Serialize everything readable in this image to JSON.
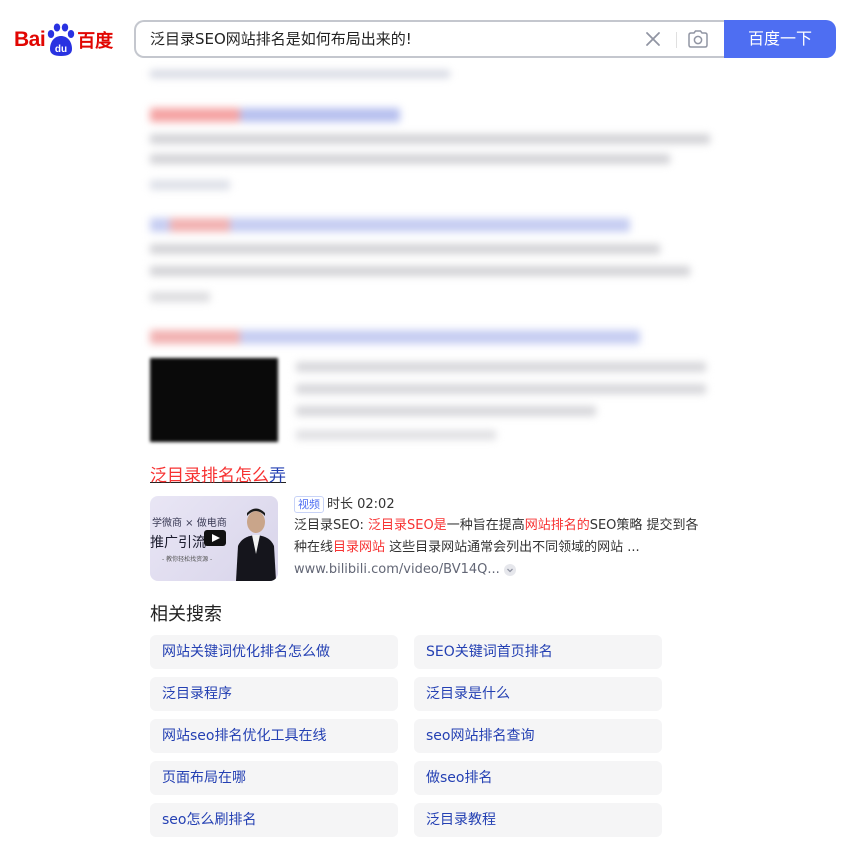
{
  "header": {
    "logo": {
      "text_left": "Bai",
      "text_mid": "du",
      "text_right": "百度",
      "color": "#e10602"
    },
    "search": {
      "query": "泛目录SEO网站排名是如何布局出来的!"
    },
    "search_button_label": "百度一下",
    "accent": "#4e6ef2"
  },
  "result": {
    "title_highlight": "泛目录排名怎么",
    "title_rest": "弄",
    "video_badge": "视频",
    "duration_label": "时长 02:02",
    "thumbnail": {
      "line1": "学微商 × 做电商",
      "line2": "推广引流",
      "line3": "- 教你轻松找资源 -"
    },
    "description": [
      {
        "text": "泛目录SEO: ",
        "hl": false
      },
      {
        "text": "泛目录SEO是",
        "hl": true
      },
      {
        "text": "一种旨在提高",
        "hl": false
      },
      {
        "text": "网站排名的",
        "hl": true
      },
      {
        "text": "SEO策略 提交到各种在线",
        "hl": false
      },
      {
        "text": "目录网站",
        "hl": true
      },
      {
        "text": " 这些目录网站通常会列出不同领域的网站 ...",
        "hl": false
      }
    ],
    "source_url": "www.bilibili.com/video/BV14Q..."
  },
  "related": {
    "title": "相关搜索",
    "items": [
      "网站关键词优化排名怎么做",
      "SEO关键词首页排名",
      "泛目录程序",
      "泛目录是什么",
      "网站seo排名优化工具在线",
      "seo网站排名查询",
      "页面布局在哪",
      "做seo排名",
      "seo怎么刷排名",
      "泛目录教程"
    ]
  },
  "colors": {
    "highlight": "#f73131",
    "link": "#2440b3",
    "chip_bg": "#f5f5f6"
  }
}
